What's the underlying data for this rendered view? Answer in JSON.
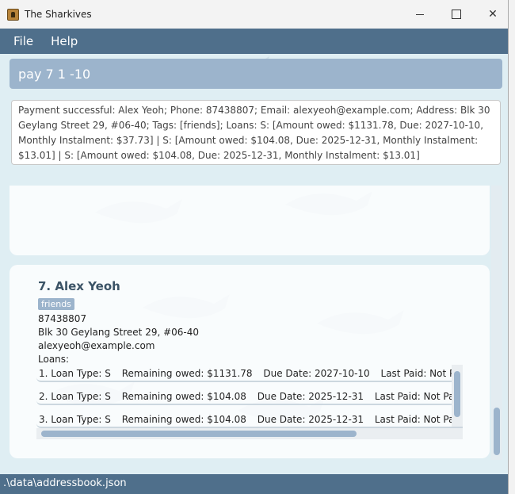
{
  "window": {
    "title": "The Sharkives",
    "close_glyph": "✕"
  },
  "menu": {
    "file": "File",
    "help": "Help"
  },
  "command": {
    "value": "pay 7 1 -10"
  },
  "result": {
    "text": "Payment successful: Alex Yeoh; Phone: 87438807; Email: alexyeoh@example.com; Address: Blk 30 Geylang Street 29, #06-40; Tags: [friends]; Loans: S: [Amount owed: $1131.78, Due: 2027-10-10, Monthly Instalment: $37.73]  | S: [Amount owed: $104.08, Due: 2025-12-31, Monthly Instalment: $13.01]  | S: [Amount owed: $104.08, Due: 2025-12-31, Monthly Instalment: $13.01]"
  },
  "person": {
    "header": "7.  Alex Yeoh",
    "tag": "friends",
    "phone": "87438807",
    "address": "Blk 30 Geylang Street 29, #06-40",
    "email": "alexyeoh@example.com",
    "loans_label": "Loans:",
    "loans": [
      {
        "type": "1. Loan Type: S",
        "remaining": "Remaining owed: $1131.78",
        "due": "Due Date: 2027-10-10",
        "last_paid": "Last Paid: Not Paid Yet"
      },
      {
        "type": "2. Loan Type: S",
        "remaining": "Remaining owed: $104.08",
        "due": "Due Date: 2025-12-31",
        "last_paid": "Last Paid: Not Paid Yet"
      },
      {
        "type": "3. Loan Type: S",
        "remaining": "Remaining owed: $104.08",
        "due": "Due Date: 2025-12-31",
        "last_paid": "Last Paid: Not Paid Yet"
      }
    ]
  },
  "status": {
    "path": ".\\data\\addressbook.json"
  },
  "colors": {
    "accent": "#4f6f8b",
    "command_bg": "#9cb4cc",
    "background": "#dfeef3"
  }
}
